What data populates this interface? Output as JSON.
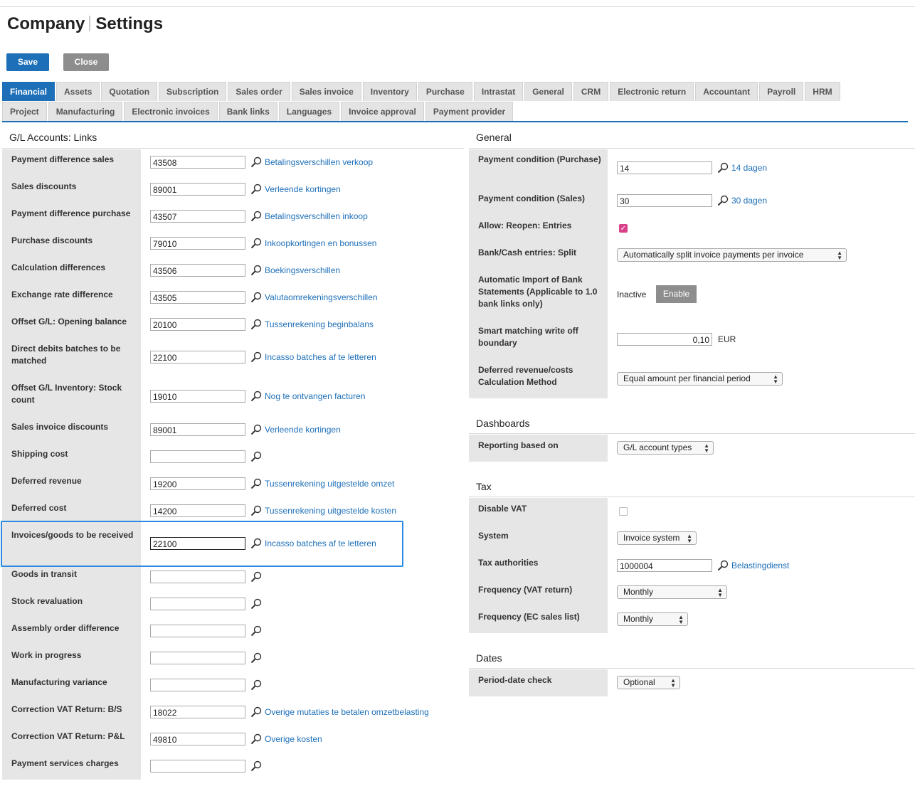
{
  "title": {
    "part1": "Company",
    "part2": "Settings"
  },
  "toolbar": {
    "save_label": "Save",
    "close_label": "Close"
  },
  "tabs_row1": [
    "Financial",
    "Assets",
    "Quotation",
    "Subscription",
    "Sales order",
    "Sales invoice",
    "Inventory",
    "Purchase",
    "Intrastat",
    "General",
    "CRM",
    "Electronic return",
    "Accountant",
    "Payroll",
    "HRM"
  ],
  "tabs_row2": [
    "Project",
    "Manufacturing",
    "Electronic invoices",
    "Bank links",
    "Languages",
    "Invoice approval",
    "Payment provider"
  ],
  "left": {
    "title": "G/L Accounts: Links",
    "rows": [
      {
        "label": "Payment difference sales",
        "value": "43508",
        "link": "Betalingsverschillen verkoop"
      },
      {
        "label": "Sales discounts",
        "value": "89001",
        "link": "Verleende kortingen"
      },
      {
        "label": "Payment difference purchase",
        "value": "43507",
        "link": "Betalingsverschillen inkoop"
      },
      {
        "label": "Purchase discounts",
        "value": "79010",
        "link": "Inkoopkortingen en bonussen"
      },
      {
        "label": "Calculation differences",
        "value": "43506",
        "link": "Boekingsverschillen"
      },
      {
        "label": "Exchange rate difference",
        "value": "43505",
        "link": "Valutaomrekeningsverschillen"
      },
      {
        "label": "Offset G/L: Opening balance",
        "value": "20100",
        "link": "Tussenrekening beginbalans"
      },
      {
        "label": "Direct debits batches to be matched",
        "value": "22100",
        "link": "Incasso batches af te letteren"
      },
      {
        "label": "Offset G/L Inventory: Stock count",
        "value": "19010",
        "link": "Nog te ontvangen facturen"
      },
      {
        "label": "Sales invoice discounts",
        "value": "89001",
        "link": "Verleende kortingen"
      },
      {
        "label": "Shipping cost",
        "value": "",
        "link": ""
      },
      {
        "label": "Deferred revenue",
        "value": "19200",
        "link": "Tussenrekening uitgestelde omzet"
      },
      {
        "label": "Deferred cost",
        "value": "14200",
        "link": "Tussenrekening uitgestelde kosten"
      },
      {
        "label": "Invoices/goods to be received",
        "value": "22100",
        "link": "Incasso batches af te letteren"
      },
      {
        "label": "Goods in transit",
        "value": "",
        "link": ""
      },
      {
        "label": "Stock revaluation",
        "value": "",
        "link": ""
      },
      {
        "label": "Assembly order difference",
        "value": "",
        "link": ""
      },
      {
        "label": "Work in progress",
        "value": "",
        "link": ""
      },
      {
        "label": "Manufacturing variance",
        "value": "",
        "link": ""
      },
      {
        "label": "Correction VAT Return: B/S",
        "value": "18022",
        "link": "Overige mutaties te betalen omzetbelasting"
      },
      {
        "label": "Correction VAT Return: P&L",
        "value": "49810",
        "link": "Overige kosten"
      },
      {
        "label": "Payment services charges",
        "value": "",
        "link": ""
      }
    ]
  },
  "general": {
    "title": "General",
    "payment_condition_purchase": {
      "label": "Payment condition (Purchase)",
      "value": "14",
      "link": "14 dagen"
    },
    "payment_condition_sales": {
      "label": "Payment condition (Sales)",
      "value": "30",
      "link": "30 dagen"
    },
    "allow_reopen": {
      "label": "Allow: Reopen: Entries",
      "checked": true
    },
    "bank_cash_split": {
      "label": "Bank/Cash entries: Split",
      "value": "Automatically split invoice payments per invoice"
    },
    "auto_import": {
      "label": "Automatic Import of Bank Statements (Applicable to 1.0 bank links only)",
      "status": "Inactive",
      "button": "Enable"
    },
    "smart_matching": {
      "label": "Smart matching write off boundary",
      "value": "0,10",
      "currency": "EUR"
    },
    "deferred_method": {
      "label": "Deferred revenue/costs Calculation Method",
      "value": "Equal amount per financial period"
    }
  },
  "dashboards": {
    "title": "Dashboards",
    "reporting_label": "Reporting based on",
    "reporting_value": "G/L account types"
  },
  "tax": {
    "title": "Tax",
    "disable_vat": {
      "label": "Disable VAT",
      "checked": false
    },
    "system": {
      "label": "System",
      "value": "Invoice system"
    },
    "authorities": {
      "label": "Tax authorities",
      "value": "1000004",
      "link": "Belastingdienst"
    },
    "freq_vat": {
      "label": "Frequency (VAT return)",
      "value": "Monthly"
    },
    "freq_ec": {
      "label": "Frequency (EC sales list)",
      "value": "Monthly"
    }
  },
  "dates": {
    "title": "Dates",
    "period_label": "Period-date check",
    "period_value": "Optional"
  },
  "colors": {
    "accent": "#1d6fb8",
    "highlight": "#2a8ae6",
    "label_bg": "#e6e6e6"
  }
}
